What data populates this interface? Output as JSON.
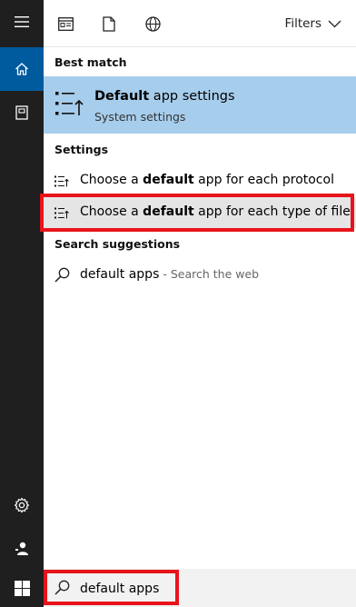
{
  "toolbar": {
    "filters_label": "Filters"
  },
  "sections": {
    "best_match": "Best match",
    "settings": "Settings",
    "search_suggestions": "Search suggestions"
  },
  "best_match": {
    "title_bold": "Default",
    "title_rest": " app settings",
    "subtitle": "System settings"
  },
  "settings_items": [
    {
      "pre": "Choose a ",
      "bold": "default",
      "post": " app for each protocol"
    },
    {
      "pre": "Choose a ",
      "bold": "default",
      "post": " app for each type of file"
    }
  ],
  "suggestion": {
    "query": "default apps",
    "separator": " - ",
    "source": "Search the web"
  },
  "search": {
    "value": "default apps"
  },
  "colors": {
    "rail": "#1f1f1f",
    "active_rail": "#005a9e",
    "best_match_bg": "#a7cdec",
    "highlight": "#e8141b"
  }
}
